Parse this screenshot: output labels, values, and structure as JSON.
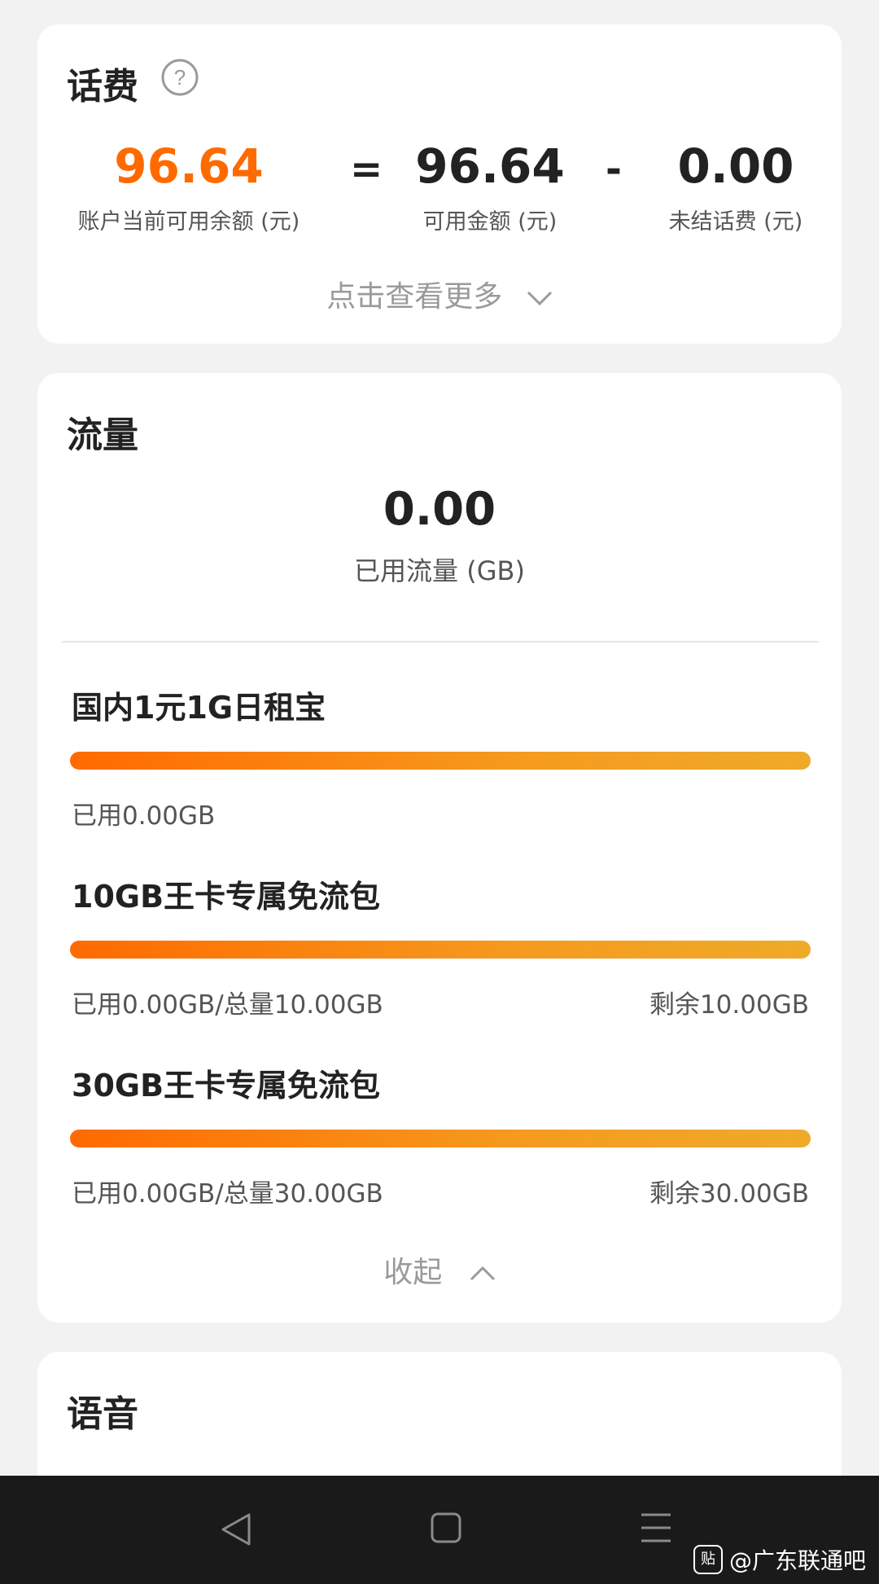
{
  "balance_card": {
    "title": "话费",
    "current_balance": "96.64",
    "current_balance_label": "账户当前可用余额 (元)",
    "equals": "=",
    "available": "96.64",
    "available_label": "可用金额 (元)",
    "minus": "-",
    "unsettled": "0.00",
    "unsettled_label": "未结话费 (元)",
    "more_label": "点击查看更多",
    "accent_color": "#ff6a00"
  },
  "data_card": {
    "title": "流量",
    "used_value": "0.00",
    "used_label": "已用流量 (GB)",
    "packages": [
      {
        "name": "国内1元1G日租宝",
        "used": "已用0.00GB",
        "remain": "",
        "fill": 1.0
      },
      {
        "name": "10GB王卡专属免流包",
        "used": "已用0.00GB/总量10.00GB",
        "remain": "剩余10.00GB",
        "fill": 1.0
      },
      {
        "name": "30GB王卡专属免流包",
        "used": "已用0.00GB/总量30.00GB",
        "remain": "剩余30.00GB",
        "fill": 1.0
      }
    ],
    "collapse_label": "收起"
  },
  "voice_card": {
    "title": "语音"
  },
  "navbar": {
    "back_icon": "triangle-back-icon",
    "home_icon": "square-home-icon",
    "menu_icon": "menu-lines-icon"
  },
  "watermark": {
    "logo_text": "贴",
    "text": "@广东联通吧"
  }
}
